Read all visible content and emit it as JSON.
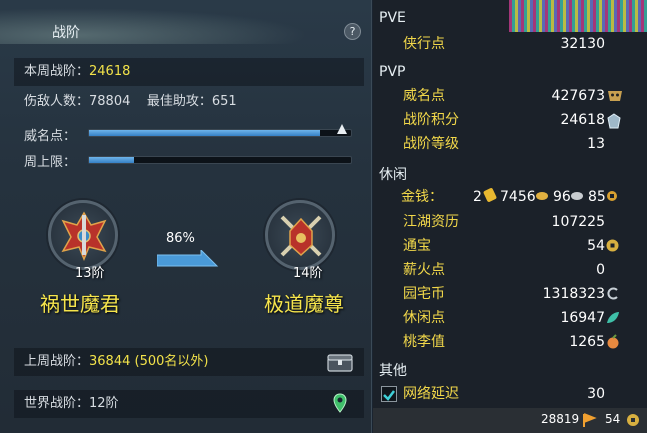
{
  "panel": {
    "title": "战阶",
    "help": "?",
    "weekly_label": "本周战阶：",
    "weekly_value": "24618",
    "stats_text": "伤敌人数：78804    最佳助攻：651",
    "prestige_label": "威名点：",
    "prestige_progress": 0.88,
    "weekly_cap_label": "周上限：",
    "weekly_cap_progress": 0.17,
    "progress_percent": "86%",
    "current_rank": {
      "level": "13阶",
      "name": "祸世魔君"
    },
    "next_rank": {
      "level": "14阶",
      "name": "极道魔尊"
    },
    "last_week_label": "上周战阶：",
    "last_week_value": "36844 (500名以外)",
    "world_label": "世界战阶：12阶"
  },
  "stats": {
    "pve_header": "PVE",
    "pve": [
      {
        "label": "侠行点",
        "value": "32130"
      }
    ],
    "pvp_header": "PVP",
    "pvp": [
      {
        "label": "威名点",
        "value": "427673"
      },
      {
        "label": "战阶积分",
        "value": "24618"
      },
      {
        "label": "战阶等级",
        "value": "13"
      }
    ],
    "leisure_header": "休闲",
    "money_label": "金钱：",
    "money": {
      "a": "2",
      "b": "7456",
      "c": "96",
      "d": "85"
    },
    "leisure": [
      {
        "label": "江湖资历",
        "value": "107225"
      },
      {
        "label": "通宝",
        "value": "54"
      },
      {
        "label": "薪火点",
        "value": "0"
      },
      {
        "label": "园宅币",
        "value": "1318323"
      },
      {
        "label": "休闲点",
        "value": "16947"
      },
      {
        "label": "桃李值",
        "value": "1265"
      }
    ],
    "other_header": "其他",
    "other": [
      {
        "label": "网络延迟",
        "value": "30"
      }
    ],
    "footer": {
      "value1": "28819",
      "value2": "54"
    }
  },
  "colors": {
    "accent_yellow": "#f2e24a",
    "bar_blue": "#4a9ad8",
    "label_gold": "#f2d84a"
  }
}
